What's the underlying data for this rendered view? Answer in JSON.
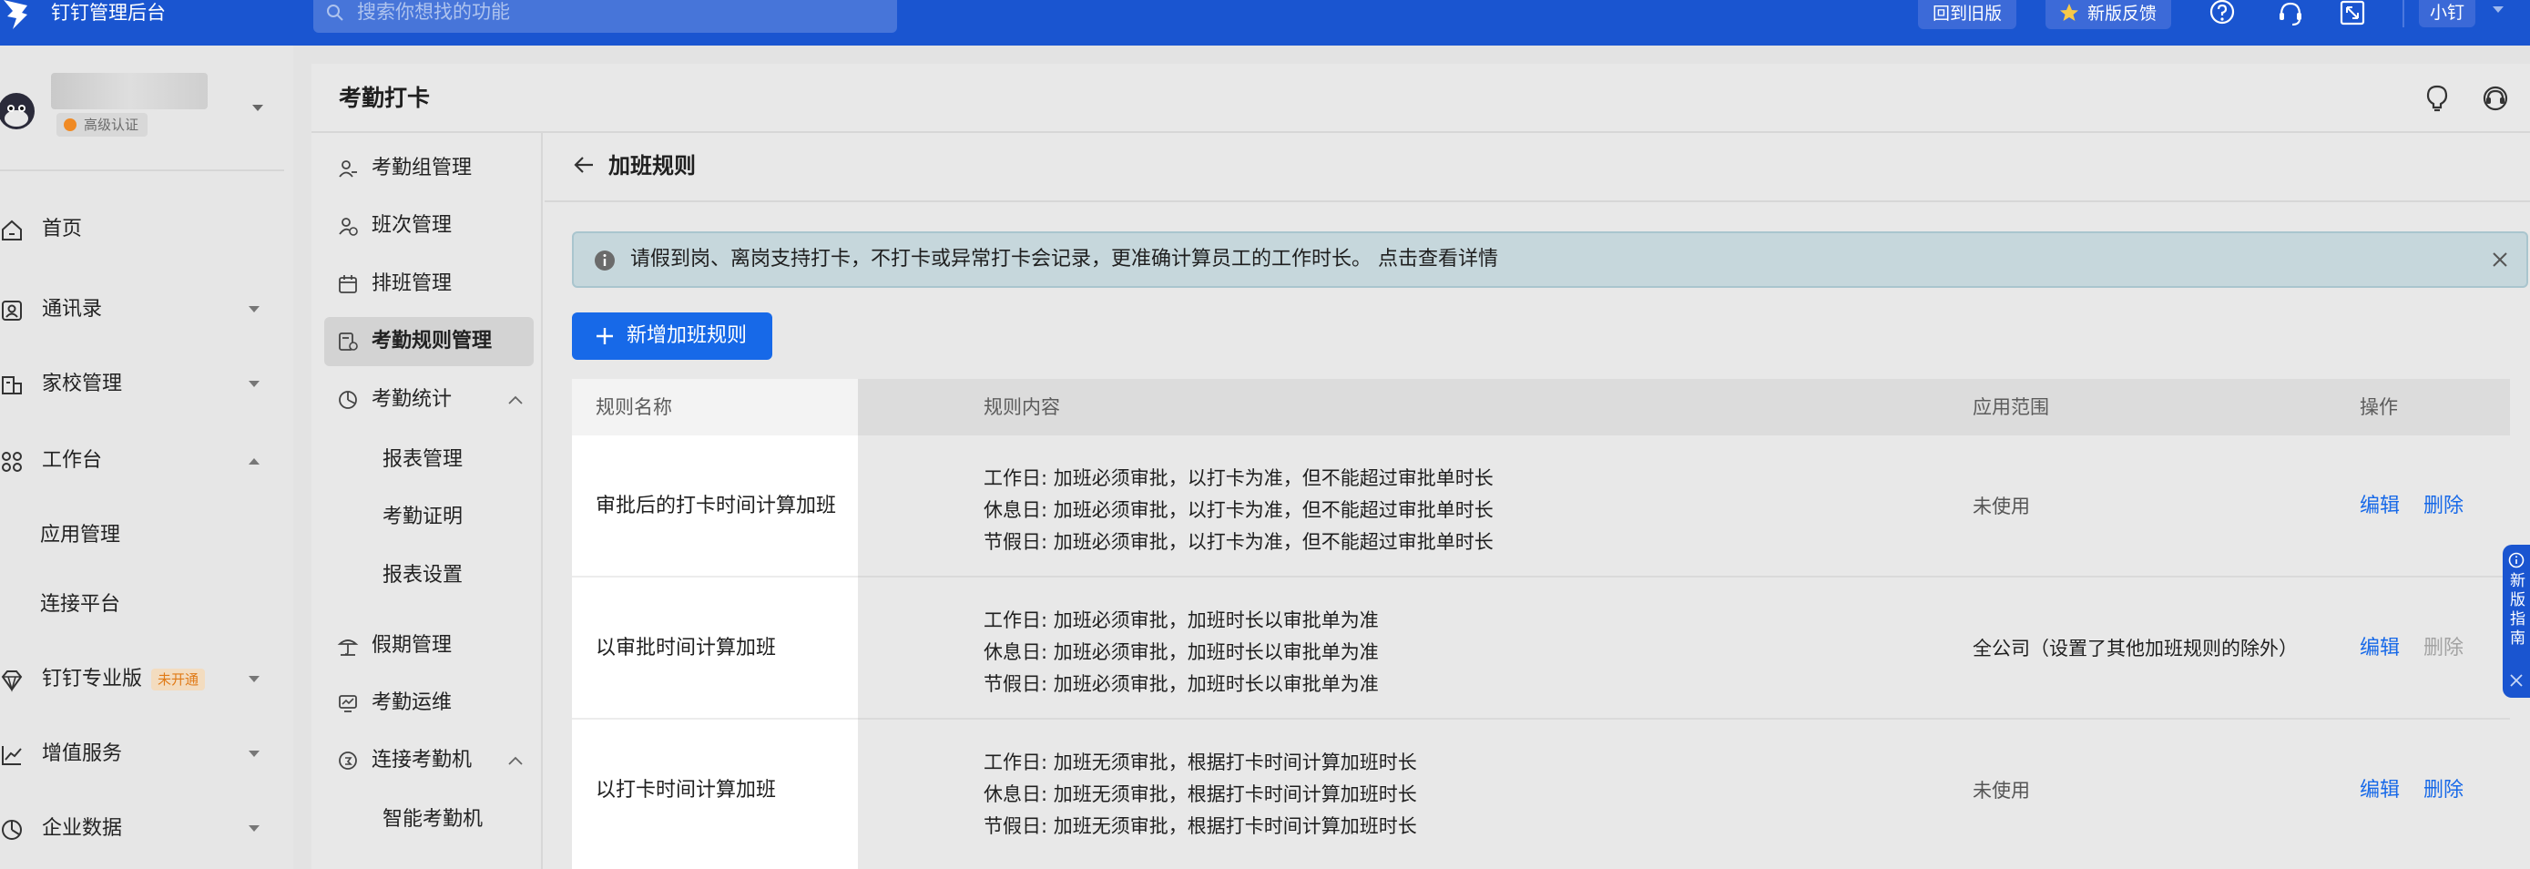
{
  "topbar": {
    "app_title": "钉钉管理后台",
    "search_placeholder": "搜索你想找的功能",
    "old_version_label": "回到旧版",
    "feedback_label": "新版反馈",
    "user_label": "小钉"
  },
  "sidebar": {
    "cert_label": "高级认证",
    "items": [
      {
        "label": "首页"
      },
      {
        "label": "通讯录"
      },
      {
        "label": "家校管理"
      },
      {
        "label": "工作台"
      },
      {
        "label": "钉钉专业版",
        "tag": "未开通"
      },
      {
        "label": "增值服务"
      },
      {
        "label": "企业数据"
      }
    ],
    "workbench_children": [
      "应用管理",
      "连接平台"
    ]
  },
  "panel": {
    "title": "考勤打卡"
  },
  "subnav": {
    "items": [
      {
        "label": "考勤组管理"
      },
      {
        "label": "班次管理"
      },
      {
        "label": "排班管理"
      },
      {
        "label": "考勤规则管理"
      },
      {
        "label": "考勤统计"
      },
      {
        "label": "假期管理"
      },
      {
        "label": "考勤运维"
      },
      {
        "label": "连接考勤机"
      }
    ],
    "stats_children": [
      "报表管理",
      "考勤证明",
      "报表设置"
    ],
    "machine_children": [
      "智能考勤机"
    ]
  },
  "main": {
    "title": "加班规则",
    "notice": "请假到岗、离岗支持打卡，不打卡或异常打卡会记录，更准确计算员工的工作时长。 点击查看详情",
    "add_button": "新增加班规则",
    "columns": [
      "规则名称",
      "规则内容",
      "应用范围",
      "操作"
    ],
    "rows": [
      {
        "name": "审批后的打卡时间计算加班",
        "content": [
          "工作日: 加班必须审批，以打卡为准，但不能超过审批单时长",
          "休息日: 加班必须审批，以打卡为准，但不能超过审批单时长",
          "节假日: 加班必须审批，以打卡为准，但不能超过审批单时长"
        ],
        "scope": "未使用",
        "edit": "编辑",
        "delete": "删除"
      },
      {
        "name": "以审批时间计算加班",
        "content": [
          "工作日: 加班必须审批，加班时长以审批单为准",
          "休息日: 加班必须审批，加班时长以审批单为准",
          "节假日: 加班必须审批，加班时长以审批单为准"
        ],
        "scope": "全公司（设置了其他加班规则的除外）",
        "edit": "编辑",
        "delete": "删除"
      },
      {
        "name": "以打卡时间计算加班",
        "content": [
          "工作日: 加班无须审批，根据打卡时间计算加班时长",
          "休息日: 加班无须审批，根据打卡时间计算加班时长",
          "节假日: 加班无须审批，根据打卡时间计算加班时长"
        ],
        "scope": "未使用",
        "edit": "编辑",
        "delete": "删除"
      }
    ]
  },
  "guide": {
    "label": "新版指南"
  },
  "colors": {
    "topbar": "#1a55d0",
    "primary": "#1769e8",
    "notice_bg": "#c6d7dc",
    "tag_text": "#e07a16"
  }
}
